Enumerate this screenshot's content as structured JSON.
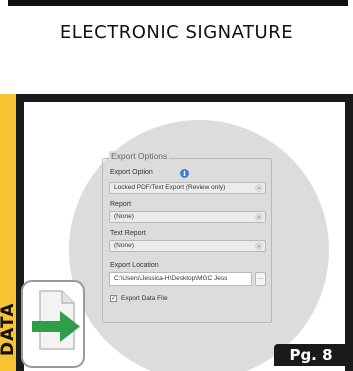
{
  "header": {
    "title": "ELECTRONIC SIGNATURE"
  },
  "side_tab": {
    "label": "DATA",
    "color": "#f7c332"
  },
  "export_options": {
    "legend": "Export Options",
    "export_option": {
      "label": "Export Option",
      "value": "Locked PDF/Text Export (Review only)"
    },
    "report": {
      "label": "Report",
      "value": "(None)"
    },
    "text_report": {
      "label": "Text Report",
      "value": "(None)"
    },
    "export_location": {
      "label": "Export Location",
      "value": "C:\\Users\\Jessica-H\\Desktop\\MGC Jess",
      "browse_label": "..."
    },
    "export_data_file": {
      "label": "Export Data File",
      "checked": true
    }
  },
  "icons": {
    "info": "info-icon",
    "file_export": "file-export-icon"
  },
  "footer": {
    "page_label": "Pg. 8"
  }
}
